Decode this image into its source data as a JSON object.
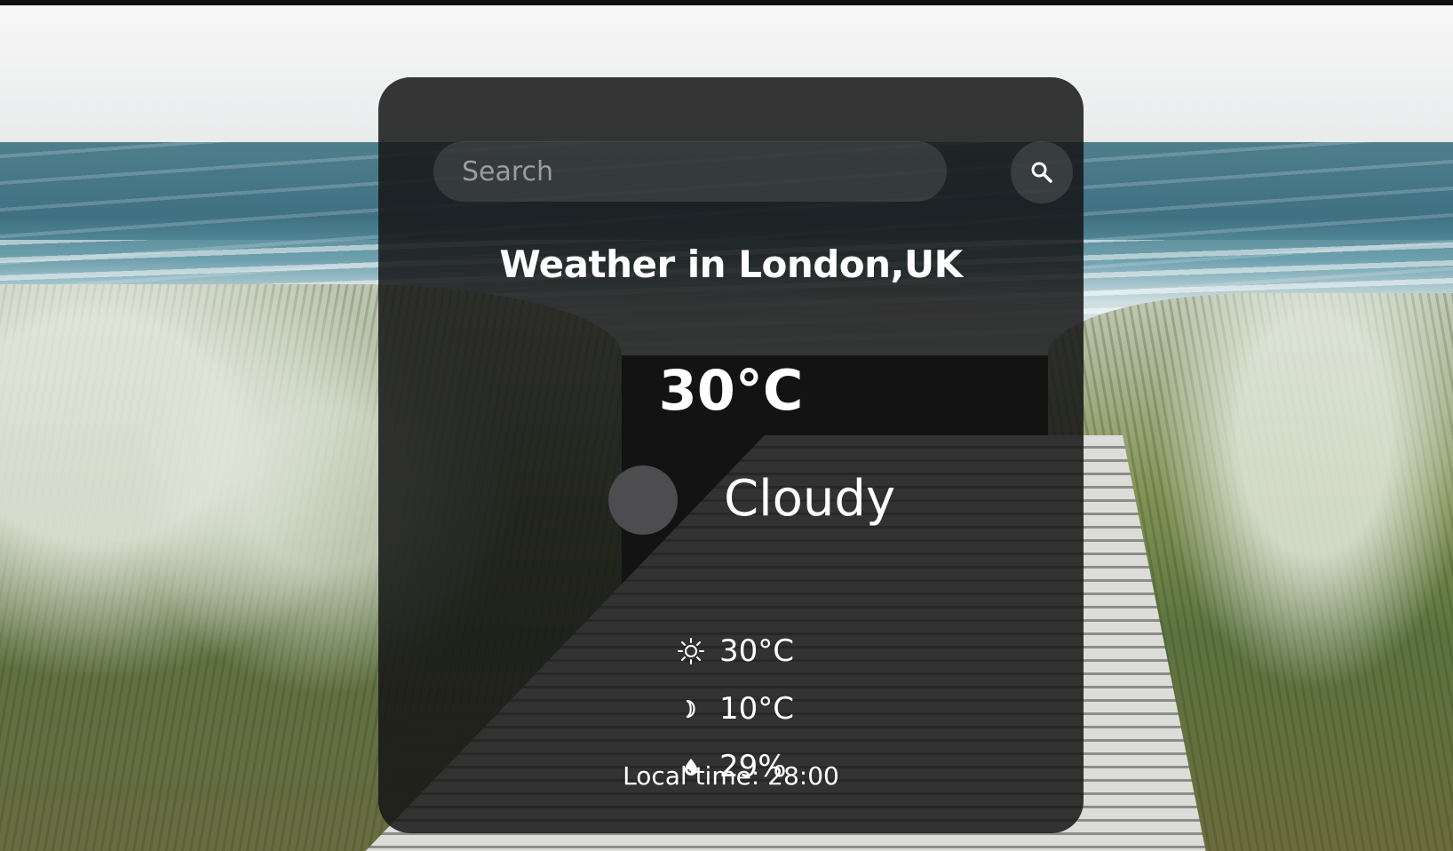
{
  "search": {
    "placeholder": "Search",
    "value": "",
    "button_icon": "search-icon"
  },
  "weather": {
    "title": "Weather in London,UK",
    "temperature": "30°C",
    "condition": "Cloudy",
    "condition_icon": "cloud-placeholder-icon",
    "high": {
      "icon": "sun-icon",
      "value": "30°C"
    },
    "low": {
      "icon": "moon-icon",
      "value": "10°C"
    },
    "humidity": {
      "icon": "droplet-icon",
      "value": "29%"
    },
    "local_time": "Local time: 28:00"
  },
  "colors": {
    "card_background": "#161616",
    "text": "#ffffff",
    "input_background": "#5a5a5a",
    "icon_placeholder": "#4d4d4f"
  }
}
